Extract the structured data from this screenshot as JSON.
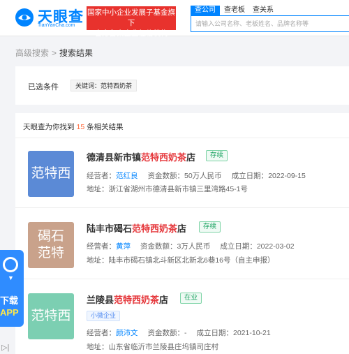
{
  "header": {
    "logo_text": "天眼查",
    "logo_sub": "TianYanCha.com",
    "banner_line1": "国家中小企业发展子基金旗下",
    "banner_line2": "官方备案企业征信机构",
    "tabs": [
      "查公司",
      "查老板",
      "查关系"
    ],
    "search_placeholder": "请输入公司名称、老板姓名、品牌名称等",
    "accent": "#0084ff"
  },
  "breadcrumb": {
    "parent": "高级搜索",
    "separator": ">",
    "current": "搜索结果"
  },
  "filter": {
    "label": "已选条件",
    "tag": "关键词：范特西奶茶"
  },
  "results": {
    "prefix": "天眼查为你找到",
    "count": "15",
    "suffix": "条相关结果",
    "items": [
      {
        "thumb": "范特西",
        "thumb_color": "#5b8ad6",
        "name_prefix": "德清县新市镇",
        "name_highlight": "范特西奶茶",
        "name_suffix": "店",
        "status": "存续",
        "tag": "",
        "legal_label": "经营者：",
        "legal": "范红良",
        "capital_label": "资金数额：",
        "capital": "50万人民币",
        "date_label": "成立日期：",
        "date": "2022-09-15",
        "addr_label": "地址：",
        "addr": "浙江省湖州市德清县新市镇三里湾路45-1号"
      },
      {
        "thumb": "碣石范特",
        "thumb_color": "#c9a28b",
        "name_prefix": "陆丰市碣石",
        "name_highlight": "范特西奶茶",
        "name_suffix": "店",
        "status": "存续",
        "tag": "",
        "legal_label": "经营者：",
        "legal": "黄萍",
        "capital_label": "资金数额：",
        "capital": "3万人民币",
        "date_label": "成立日期：",
        "date": "2022-03-02",
        "addr_label": "地址：",
        "addr": "陆丰市碣石镇北斗新区北新北6巷16号（自主申报）"
      },
      {
        "thumb": "范特西",
        "thumb_color": "#7ccfb2",
        "name_prefix": "兰陵县",
        "name_highlight": "范特西奶茶",
        "name_suffix": "店",
        "status": "在业",
        "tag": "小微企业",
        "legal_label": "经营者：",
        "legal": "颜沛文",
        "capital_label": "资金数额：",
        "capital": "-",
        "date_label": "成立日期：",
        "date": "2021-10-21",
        "addr_label": "地址：",
        "addr": "山东省临沂市兰陵县庄坞镇司庄村"
      }
    ]
  },
  "floating_app": {
    "line1": "下载",
    "line2": "APP"
  },
  "icons": {
    "logo": "eye-logo-icon",
    "app": "app-download-icon",
    "collapse": "collapse-icon"
  }
}
